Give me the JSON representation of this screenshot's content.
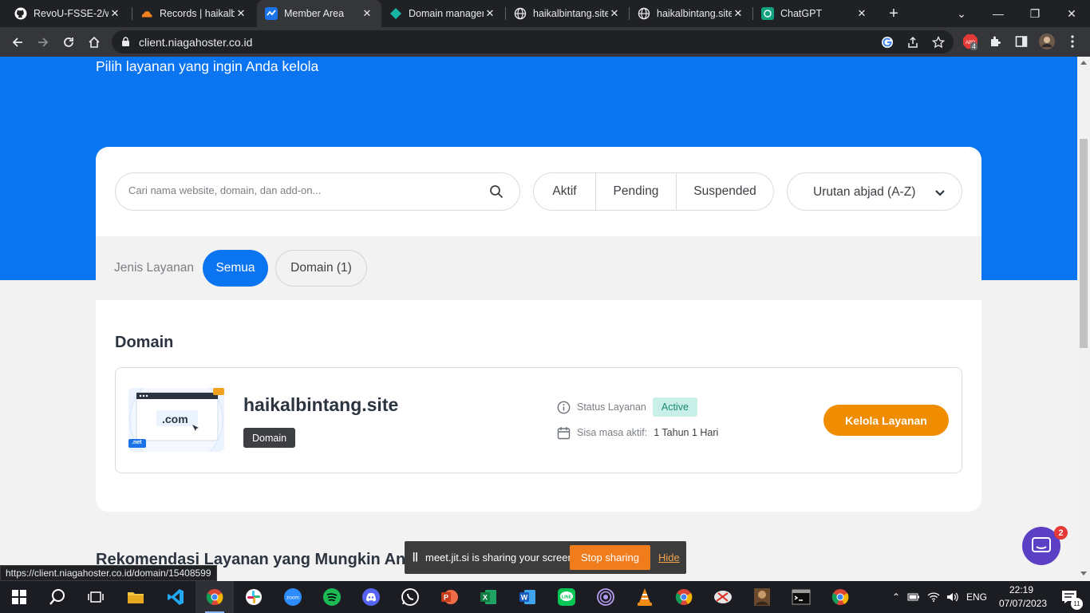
{
  "browser": {
    "tabs": [
      {
        "label": "RevoU-FSSE-2/w",
        "icon": "github-icon"
      },
      {
        "label": "Records | haikalb",
        "icon": "cloudflare-icon"
      },
      {
        "label": "Member Area",
        "icon": "niagahoster-icon",
        "active": true
      },
      {
        "label": "Domain manager",
        "icon": "domain-manager-icon"
      },
      {
        "label": "haikalbintang.site",
        "icon": "globe-icon"
      },
      {
        "label": "haikalbintang.site",
        "icon": "globe-icon"
      },
      {
        "label": "ChatGPT",
        "icon": "chatgpt-icon"
      }
    ],
    "url": "client.niagahoster.co.id",
    "extension_badge": "4",
    "status_url": "https://client.niagahoster.co.id/domain/15408599"
  },
  "hero": {
    "subtitle": "Pilih layanan yang ingin Anda kelola"
  },
  "search": {
    "placeholder": "Cari nama website, domain, dan add-on..."
  },
  "status_filter": [
    "Aktif",
    "Pending",
    "Suspended"
  ],
  "sort": {
    "label": "Urutan abjad (A-Z)"
  },
  "service_type": {
    "label": "Jenis Layanan",
    "options": [
      {
        "label": "Semua",
        "selected": true
      },
      {
        "label": "Domain (1)",
        "selected": false
      }
    ]
  },
  "section": {
    "title": "Domain"
  },
  "service": {
    "name": "haikalbintang.site",
    "type_badge": "Domain",
    "thumb_text": ".com",
    "thumb_net": ".net",
    "status_label": "Status Layanan",
    "status_value": "Active",
    "remaining_label": "Sisa masa aktif:",
    "remaining_value": "1 Tahun 1 Hari",
    "manage_button": "Kelola Layanan"
  },
  "recommendation": {
    "title": "Rekomendasi Layanan yang Mungkin Anda"
  },
  "chat": {
    "badge": "2"
  },
  "screen_share": {
    "message": "meet.jit.si is sharing your screen.",
    "stop": "Stop sharing",
    "hide": "Hide"
  },
  "taskbar": {
    "language": "ENG",
    "time": "22:19",
    "date": "07/07/2023",
    "notifications": "11"
  },
  "colors": {
    "brand_blue": "#0b74f0",
    "accent_orange": "#f08c00",
    "active_green_bg": "#c8efe8",
    "active_green_text": "#1b8a6c"
  }
}
